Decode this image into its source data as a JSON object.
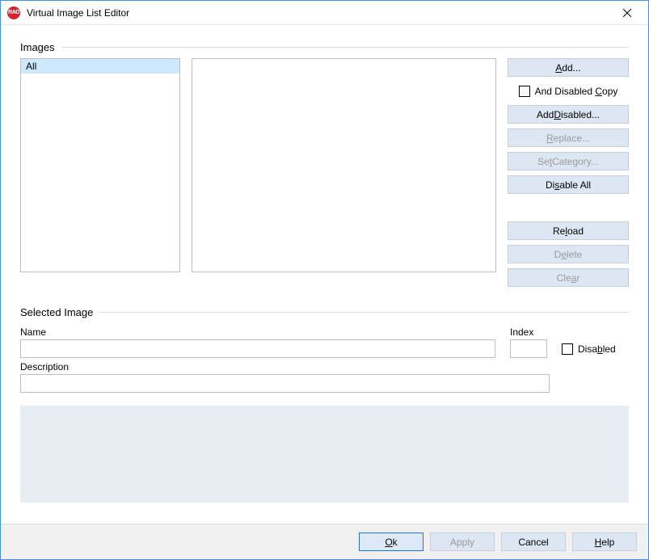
{
  "window": {
    "title": "Virtual Image List Editor",
    "icon_text": "RAD"
  },
  "images": {
    "group_label": "Images",
    "list_items": [
      "All"
    ],
    "buttons": {
      "add": "Add...",
      "add_u": "A",
      "and_disabled_copy": "And Disabled Copy",
      "and_disabled_copy_u": "C",
      "add_disabled": "Add Disabled...",
      "add_disabled_u": "D",
      "replace": "Replace...",
      "replace_u": "R",
      "set_category": "Set Category...",
      "set_category_u": "t",
      "disable_all": "Disable All",
      "disable_all_u": "s",
      "reload": "Reload",
      "reload_u": "l",
      "delete": "Delete",
      "delete_u": "e",
      "clear": "Clear",
      "clear_u": "a"
    }
  },
  "selected": {
    "group_label": "Selected Image",
    "name_label": "Name",
    "name_value": "",
    "index_label": "Index",
    "index_value": "",
    "disabled_label": "Disabled",
    "disabled_u": "b",
    "description_label": "Description",
    "description_value": ""
  },
  "footer": {
    "ok": "Ok",
    "ok_u": "O",
    "apply": "Apply",
    "cancel": "Cancel",
    "help": "Help",
    "help_u": "H"
  }
}
